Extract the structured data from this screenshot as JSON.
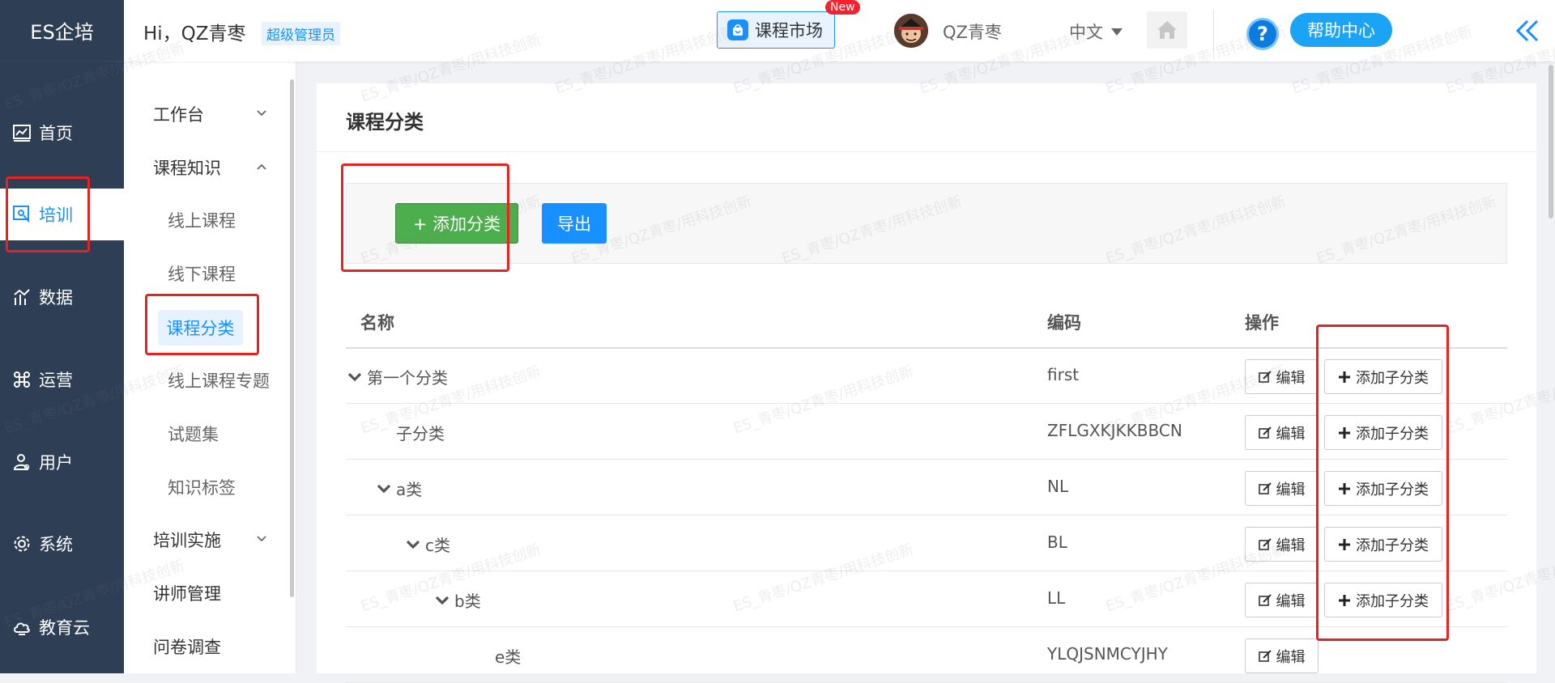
{
  "brand": "ES企培",
  "leftnav": {
    "items": [
      {
        "label": "首页",
        "icon": "chart-icon"
      },
      {
        "label": "培训",
        "icon": "training-icon",
        "active": true
      },
      {
        "label": "数据",
        "icon": "data-icon"
      },
      {
        "label": "运营",
        "icon": "operate-icon"
      },
      {
        "label": "用户",
        "icon": "user-icon"
      },
      {
        "label": "系统",
        "icon": "gear-icon"
      },
      {
        "label": "教育云",
        "icon": "cloud-icon"
      }
    ]
  },
  "submenu": {
    "groups": [
      {
        "label": "工作台",
        "expanded": false
      },
      {
        "label": "课程知识",
        "expanded": true
      },
      {
        "label": "培训实施",
        "expanded": false
      },
      {
        "label": "讲师管理"
      },
      {
        "label": "问卷调查"
      }
    ],
    "items": [
      "线上课程",
      "线下课程",
      "课程分类",
      "线上课程专题",
      "试题集",
      "知识标签"
    ],
    "active_item": "课程分类"
  },
  "header": {
    "greeting": "Hi，QZ青枣",
    "role": "超级管理员",
    "market_label": "课程市场",
    "new_badge": "New",
    "username": "QZ青枣",
    "language": "中文",
    "help_label": "帮助中心",
    "help_symbol": "?"
  },
  "page": {
    "title": "课程分类",
    "add_button": "+ 添加分类",
    "export_button": "导出"
  },
  "table": {
    "headers": {
      "name": "名称",
      "code": "编码",
      "action": "操作"
    },
    "edit_label": "编辑",
    "add_child_label": "添加子分类",
    "rows": [
      {
        "name": "第一个分类",
        "code": "first",
        "level": 0,
        "caret": true,
        "add_child": true
      },
      {
        "name": "子分类",
        "code": "ZFLGXKJKKBBCN",
        "level": 1,
        "caret": false,
        "add_child": true
      },
      {
        "name": "a类",
        "code": "NL",
        "level": 1,
        "caret": true,
        "add_child": true
      },
      {
        "name": "c类",
        "code": "BL",
        "level": 2,
        "caret": true,
        "add_child": true
      },
      {
        "name": "b类",
        "code": "LL",
        "level": 3,
        "caret": true,
        "add_child": true
      },
      {
        "name": "e类",
        "code": "YLQJSNMCYJHY",
        "level": 4,
        "caret": false,
        "add_child": false
      }
    ]
  },
  "watermark": "ES_青枣/QZ青枣/用科技创新",
  "colors": {
    "nav_bg": "#2e3e54",
    "accent": "#1890ff",
    "add_green": "#4cae4c",
    "annotation_red": "#e8231f"
  }
}
